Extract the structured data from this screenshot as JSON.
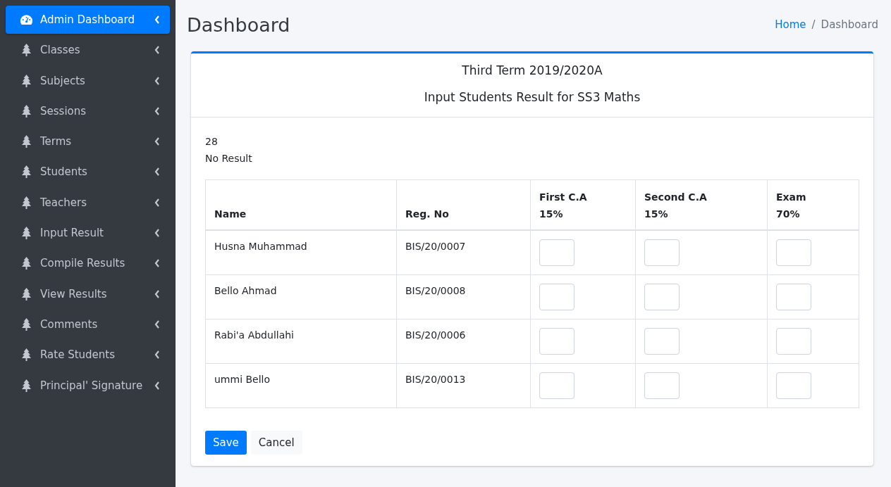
{
  "sidebar": {
    "items": [
      {
        "label": "Admin Dashboard",
        "selected": true
      },
      {
        "label": "Classes",
        "selected": false
      },
      {
        "label": "Subjects",
        "selected": false
      },
      {
        "label": "Sessions",
        "selected": false
      },
      {
        "label": "Terms",
        "selected": false
      },
      {
        "label": "Students",
        "selected": false
      },
      {
        "label": "Teachers",
        "selected": false
      },
      {
        "label": "Input Result",
        "selected": false
      },
      {
        "label": "Compile Results",
        "selected": false
      },
      {
        "label": "View Results",
        "selected": false
      },
      {
        "label": "Comments",
        "selected": false
      },
      {
        "label": "Rate Students",
        "selected": false
      },
      {
        "label": "Principal' Signature",
        "selected": false
      }
    ]
  },
  "page_title": "Dashboard",
  "breadcrumb": {
    "separator": "/",
    "items": [
      {
        "label": "Home",
        "link": true
      },
      {
        "label": "Dashboard",
        "link": false
      }
    ]
  },
  "card": {
    "term": "Third Term 2019/2020A",
    "heading": "Input Students Result for SS3 Maths",
    "count": "28",
    "status": "No Result",
    "table": {
      "columns": [
        {
          "label": "Name"
        },
        {
          "label": "Reg. No"
        },
        {
          "label": "First C.A",
          "weight": "15%"
        },
        {
          "label": "Second C.A",
          "weight": "15%"
        },
        {
          "label": "Exam",
          "weight": "70%"
        }
      ],
      "rows": [
        {
          "name": "Husna Muhammad",
          "reg_no": "BIS/20/0007"
        },
        {
          "name": "Bello Ahmad",
          "reg_no": "BIS/20/0008"
        },
        {
          "name": "Rabi'a Abdullahi",
          "reg_no": "BIS/20/0006"
        },
        {
          "name": "ummi Bello",
          "reg_no": "BIS/20/0013"
        }
      ]
    },
    "buttons": [
      {
        "label": "Save",
        "kind": "primary"
      },
      {
        "label": "Cancel",
        "kind": "plain"
      }
    ]
  }
}
